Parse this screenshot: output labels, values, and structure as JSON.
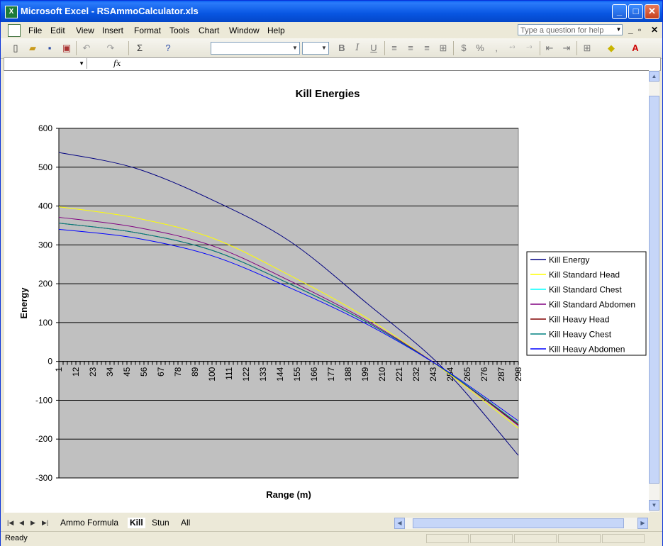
{
  "window": {
    "title": "Microsoft Excel - RSAmmoCalculator.xls",
    "app_icon": "excel-icon"
  },
  "menu": {
    "items": [
      {
        "label": "File"
      },
      {
        "label": "Edit"
      },
      {
        "label": "View"
      },
      {
        "label": "Insert"
      },
      {
        "label": "Format"
      },
      {
        "label": "Tools"
      },
      {
        "label": "Chart"
      },
      {
        "label": "Window"
      },
      {
        "label": "Help"
      }
    ],
    "ask_placeholder": "Type a question for help"
  },
  "toolbar": {
    "bold": "B",
    "italic": "I",
    "underline": "U",
    "sum": "Σ",
    "currency": "$",
    "percent": "%",
    "comma": ","
  },
  "formula_bar": {
    "fx": "fx",
    "name_box": "",
    "value": ""
  },
  "sheet_tabs": [
    {
      "label": "Ammo Formula",
      "active": false
    },
    {
      "label": "Kill",
      "active": true
    },
    {
      "label": "Stun",
      "active": false
    },
    {
      "label": "All",
      "active": false
    }
  ],
  "status": {
    "text": "Ready"
  },
  "chart_data": {
    "type": "line",
    "title": "Kill Energies",
    "xlabel": "Range (m)",
    "ylabel": "Energy",
    "ylim": [
      -300,
      600
    ],
    "yticks": [
      -300,
      -200,
      -100,
      0,
      100,
      200,
      300,
      400,
      500,
      600
    ],
    "x_tick_labels": [
      "1",
      "12",
      "23",
      "34",
      "45",
      "56",
      "67",
      "78",
      "89",
      "100",
      "111",
      "122",
      "133",
      "144",
      "155",
      "166",
      "177",
      "188",
      "199",
      "210",
      "221",
      "232",
      "243",
      "254",
      "265",
      "276",
      "287",
      "298"
    ],
    "x": [
      1,
      50,
      100,
      150,
      200,
      250,
      298
    ],
    "grid": true,
    "legend_position": "right",
    "plot_background": "#C0C0C0",
    "series": [
      {
        "name": "Kill Energy",
        "color": "#000080",
        "values": [
          538,
          498,
          416,
          310,
          150,
          -20,
          -242
        ]
      },
      {
        "name": "Kill Standard Head",
        "color": "#FFFF00",
        "values": [
          398,
          370,
          318,
          222,
          112,
          -23,
          -172
        ]
      },
      {
        "name": "Kill Standard Chest",
        "color": "#00FFFF",
        "values": [
          356,
          332,
          286,
          200,
          101,
          -21,
          -160
        ]
      },
      {
        "name": "Kill Standard Abdomen",
        "color": "#800080",
        "values": [
          371,
          346,
          298,
          208,
          105,
          -21,
          -165
        ]
      },
      {
        "name": "Kill Heavy Head",
        "color": "#800000",
        "values": [
          356,
          332,
          286,
          200,
          101,
          -21,
          -163
        ]
      },
      {
        "name": "Kill Heavy Chest",
        "color": "#008080",
        "values": [
          356,
          332,
          286,
          200,
          101,
          -21,
          -160
        ]
      },
      {
        "name": "Kill Heavy Abdomen",
        "color": "#0000FF",
        "values": [
          340,
          318,
          272,
          190,
          96,
          -20,
          -153
        ]
      }
    ]
  }
}
